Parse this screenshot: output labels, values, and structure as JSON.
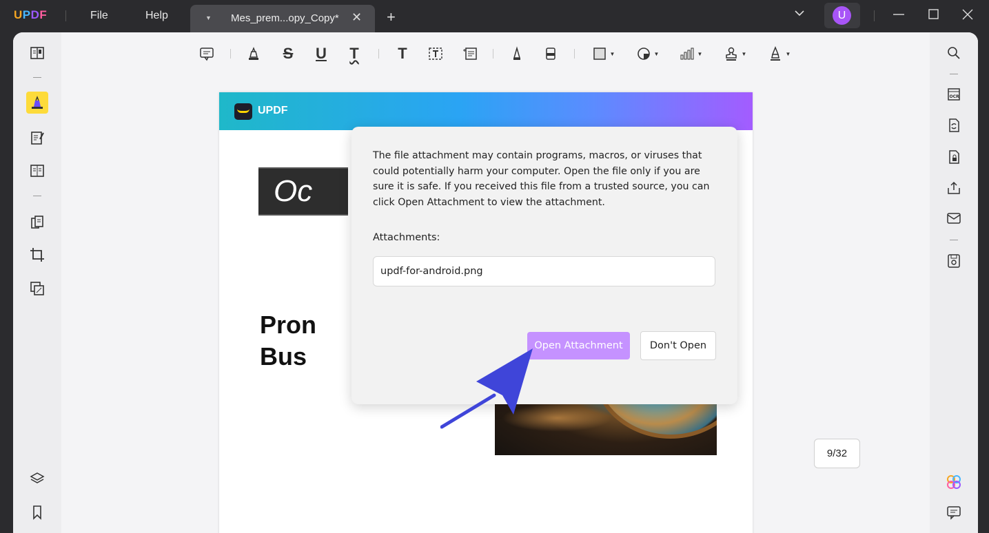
{
  "app": {
    "logo": {
      "u": "U",
      "p": "P",
      "d": "D",
      "f": "F"
    },
    "menu": {
      "file": "File",
      "help": "Help"
    },
    "tab": {
      "title": "Mes_prem...opy_Copy*",
      "close": "✕",
      "add": "+"
    },
    "avatar_letter": "U",
    "window": {
      "dropdown": "⌵",
      "minimize": "—",
      "maximize": "☐",
      "close": "✕"
    }
  },
  "toolbar": {
    "tools": [
      "comment-icon",
      "highlight-icon",
      "strikethrough-icon",
      "underline-icon",
      "squiggly-icon",
      "text-icon",
      "textbox-icon",
      "text-callout-icon",
      "pencil-icon",
      "eraser-icon",
      "shape-icon",
      "sticker-icon",
      "measure-icon",
      "stamp-icon",
      "signature-icon"
    ],
    "glyphs": {
      "strike": "S",
      "underline": "U",
      "squiggly": "T",
      "text": "T"
    }
  },
  "left_rail": [
    "reader-icon",
    "comment-mode-icon",
    "edit-pdf-icon",
    "form-icon",
    "organize-pages-icon",
    "crop-icon",
    "watermark-icon",
    "layers-icon",
    "bookmark-icon"
  ],
  "right_rail": [
    "search-icon",
    "ocr-icon",
    "convert-icon",
    "protect-icon",
    "share-icon",
    "email-icon",
    "save-icon",
    "ai-assistant-icon",
    "comments-panel-icon"
  ],
  "document": {
    "banner_logo": "UPDF",
    "dark_box_text": "Oc",
    "headline_line1": "Pron",
    "headline_line2": "Bus"
  },
  "dialog": {
    "message": "The file attachment may contain programs, macros, or viruses that could potentially harm your computer. Open the file only if you are sure it is safe. If you received this file from a trusted source, you can click Open Attachment to view the attachment.",
    "attachments_label": "Attachments:",
    "attachment_name": "updf-for-android.png",
    "open_button": "Open Attachment",
    "dont_open_button": "Don't Open"
  },
  "page_counter": "9/32",
  "colors": {
    "accent": "#c592ff",
    "active_tool": "#fddb3a",
    "arrow": "#3f45d9",
    "avatar": "#a855f7"
  }
}
